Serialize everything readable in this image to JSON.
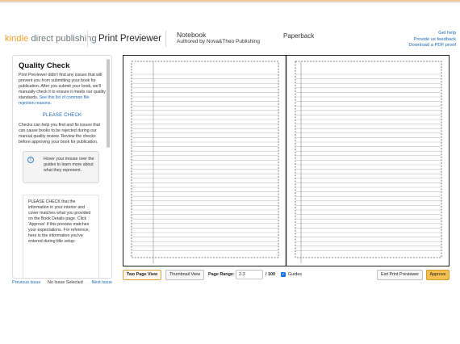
{
  "header": {
    "logo_kindle": "kindle",
    "logo_rest": " direct publishing",
    "app_title": "Print Previewer",
    "book_title": "Notebook",
    "book_author": "Authored by Nova&Theo Publishing",
    "format": "Paperback",
    "links": {
      "help": "Get help",
      "feedback": "Provide us feedback",
      "pdf": "Download a PDF proof"
    }
  },
  "panel": {
    "title": "Quality Check",
    "intro": "Print Previewer didn't find any issues that will prevent you from submitting your book for publication. After you submit your book, we'll manually check it to ensure it meets our quality standards.",
    "link": "See this list of common file rejection reasons.",
    "section_heading": "PLEASE CHECK",
    "section_text": "Checks can help you find and fix issues that can cause books to be rejected during our manual quality review. Review the checks before approving your book for publication.",
    "info_icon": "i",
    "info_text": "Hover your mouse over the guides to learn more about what they represent.",
    "check_text": "PLEASE CHECK that the information in your interior and cover matches what you provided on the Book Details page. Click 'Approve' if this preview matches your expectations. For reference, here is the information you've entered during title setup:",
    "footer": {
      "prev": "Previous Issue",
      "status": "No Issue Selected",
      "next": "Next Issue"
    }
  },
  "toolbar": {
    "two_page": "Two Page View",
    "thumbnail": "Thumbnail View",
    "range_label": "Page Range:",
    "range_value": "2-3",
    "range_total": "/ 100",
    "guides_check": "✓",
    "guides_label": "Guides",
    "exit": "Exit Print Previewer",
    "approve": "Approve"
  },
  "colors": {
    "accent": "#f0a02c",
    "link": "#1a66b6",
    "approve": "#f5c050"
  },
  "icons": {
    "info": "info-icon",
    "checkbox": "checkbox-checked-icon"
  }
}
